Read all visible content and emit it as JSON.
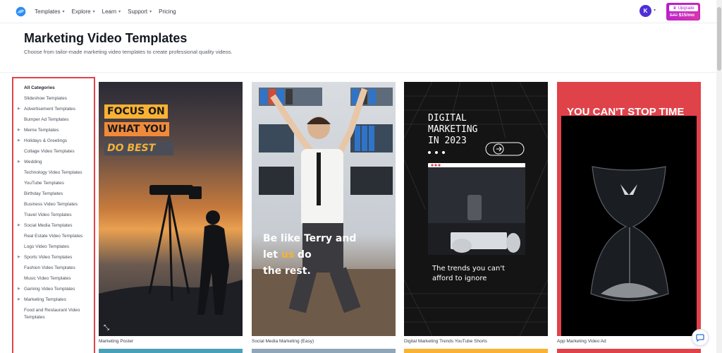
{
  "nav": {
    "items": [
      {
        "label": "Templates",
        "dropdown": true
      },
      {
        "label": "Explore",
        "dropdown": true
      },
      {
        "label": "Learn",
        "dropdown": true
      },
      {
        "label": "Support",
        "dropdown": true
      },
      {
        "label": "Pricing",
        "dropdown": false
      }
    ],
    "avatar_initial": "K",
    "upgrade_label": "Upgrade",
    "upgrade_old_price": "$30",
    "upgrade_price": "$15/mo"
  },
  "header": {
    "title": "Marketing Video Templates",
    "description": "Choose from tailor-made marketing video templates to create professional quality videos."
  },
  "sidebar": {
    "categories": [
      {
        "label": "All Categories",
        "active": true,
        "expandable": false
      },
      {
        "label": "Slideshow Templates",
        "expandable": false
      },
      {
        "label": "Advertisement Templates",
        "expandable": true
      },
      {
        "label": "Bumper Ad Templates",
        "expandable": false
      },
      {
        "label": "Meme Templates",
        "expandable": true
      },
      {
        "label": "Holidays & Greetings",
        "expandable": true
      },
      {
        "label": "Collage Video Templates",
        "expandable": false
      },
      {
        "label": "Wedding",
        "expandable": true
      },
      {
        "label": "Technology Video Templates",
        "expandable": false
      },
      {
        "label": "YouTube Templates",
        "expandable": false
      },
      {
        "label": "Birthday Templates",
        "expandable": false
      },
      {
        "label": "Business Video Templates",
        "expandable": false
      },
      {
        "label": "Travel Video Templates",
        "expandable": false
      },
      {
        "label": "Social Media Templates",
        "expandable": true
      },
      {
        "label": "Real Estate Video Templates",
        "expandable": false
      },
      {
        "label": "Logo Video Templates",
        "expandable": false
      },
      {
        "label": "Sports Video Templates",
        "expandable": true
      },
      {
        "label": "Fashion Video Templates",
        "expandable": false
      },
      {
        "label": "Music Video Templates",
        "expandable": false
      },
      {
        "label": "Gaming Video Templates",
        "expandable": true
      },
      {
        "label": "Marketing Templates",
        "expandable": true
      },
      {
        "label": "Food and Restaurant Video Templates",
        "expandable": false
      }
    ]
  },
  "cards": [
    {
      "label": "Marketing Poster",
      "lines": [
        "FOCUS ON",
        "WHAT YOU",
        "DO BEST"
      ]
    },
    {
      "label": "Social Media Marketing (Easy)",
      "line1": "Be like Terry and",
      "line2a": "let ",
      "line2b": "us",
      "line2c": " do",
      "line3": "the rest."
    },
    {
      "label": "Digital Marketing Trends YouTube Shorts",
      "lines": [
        "DIGITAL",
        "MARKETING",
        "IN 2023"
      ],
      "sub1": "The trends you can't",
      "sub2": "afford to ignore"
    },
    {
      "label": "App Marketing Video Ad",
      "headline": "YOU CAN'T STOP TIME"
    }
  ],
  "colors": {
    "accent": "#4f2fd8",
    "upgrade": "#c21ac0",
    "highlight": "#e0424a",
    "orange": "#f9b233",
    "poster_red": "#e0424a"
  }
}
